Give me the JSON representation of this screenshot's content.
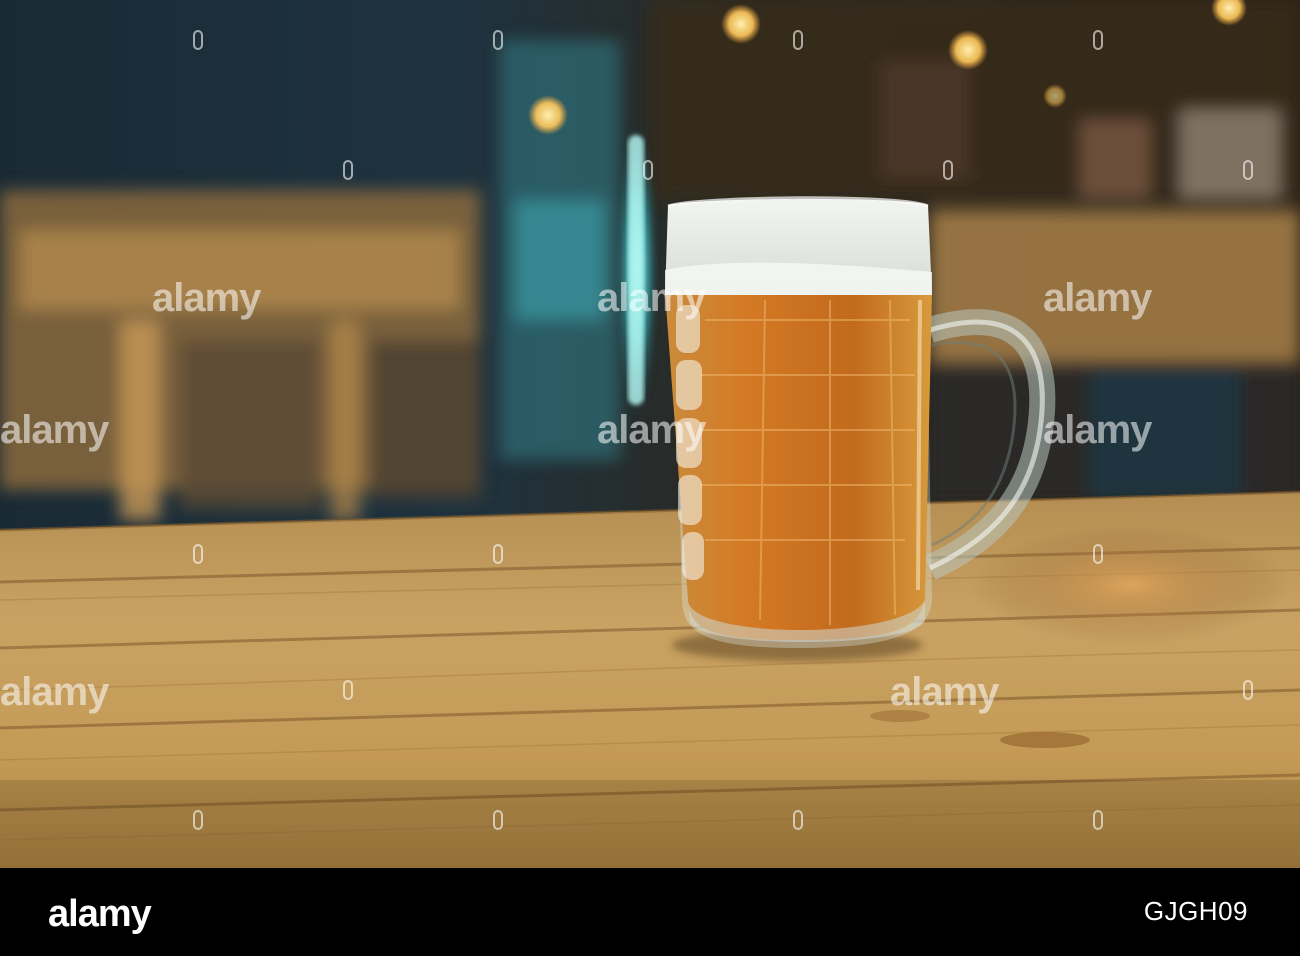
{
  "scene": {
    "subject": "glass-beer-mug-on-wooden-table"
  },
  "watermark": {
    "text": "alamy"
  },
  "footer": {
    "logo_text": "alamy",
    "image_id": "GJGH09",
    "background": "#000000"
  },
  "colors": {
    "beer": "#c8701f",
    "foam": "#e8eee8",
    "table": "#c59a52",
    "teal_light": "#4fd6d6",
    "bokeh": "#ffcf6a"
  }
}
